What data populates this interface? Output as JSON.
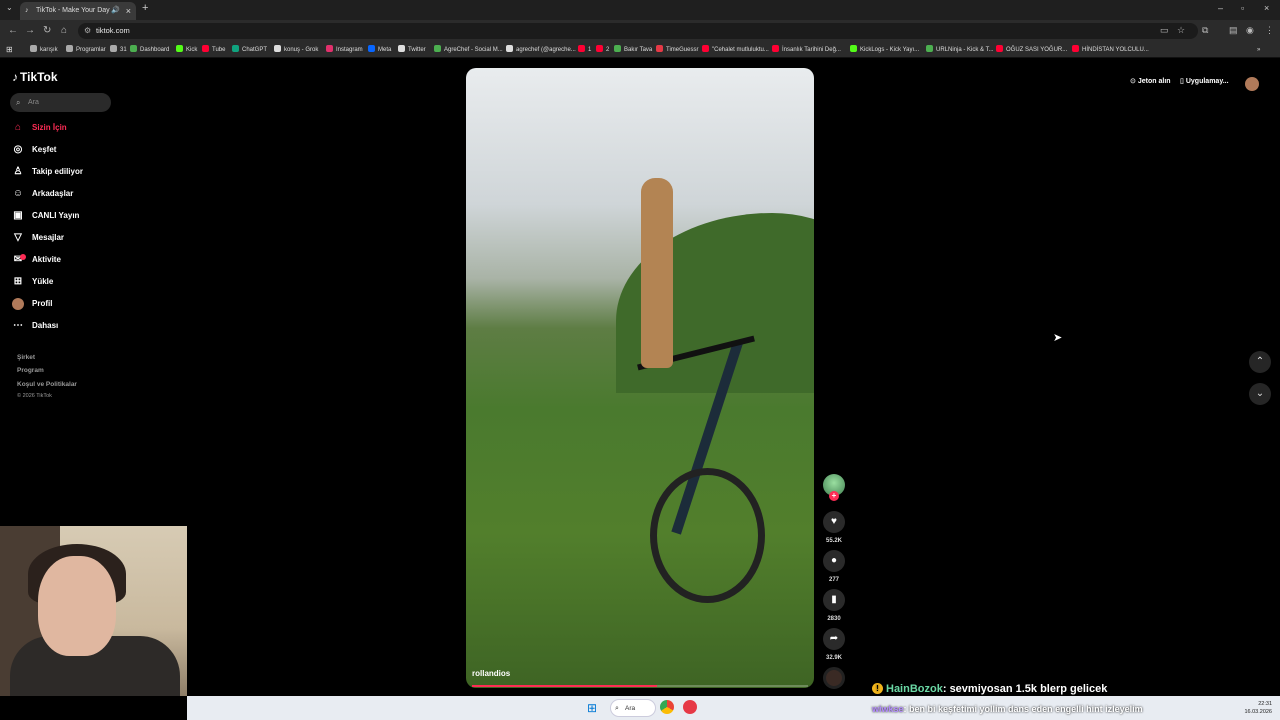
{
  "browser": {
    "tab_title": "TikTok - Make Your Day",
    "new_tab_symbol": "+",
    "url": "tiktok.com",
    "bookmarks": [
      "karışık",
      "Programlar",
      "31",
      "Dashboard",
      "Kick",
      "Tube",
      "ChatGPT",
      "konuş - Grok",
      "Instagram",
      "Meta",
      "Twitter",
      "AgreChef - Social M...",
      "agrechef (@agreche...",
      "1",
      "2",
      "Bakır Tava",
      "TimeGuessr",
      "\"Cehalet mutluluktu...",
      "İnsanlık Tarihini Değ...",
      "KickLogs - Kick Yayı...",
      "URLNinja - Kick & T...",
      "OĞUZ SASI YOĞUR...",
      "HİNDİSTAN YOLCULU..."
    ]
  },
  "sidebar": {
    "logo": "TikTok",
    "search_placeholder": "Ara",
    "items": [
      {
        "label": "Sizin İçin",
        "icon": "home-icon"
      },
      {
        "label": "Keşfet",
        "icon": "compass-icon"
      },
      {
        "label": "Takip ediliyor",
        "icon": "following-icon"
      },
      {
        "label": "Arkadaşlar",
        "icon": "friends-icon"
      },
      {
        "label": "CANLI Yayın",
        "icon": "live-icon"
      },
      {
        "label": "Mesajlar",
        "icon": "messages-icon"
      },
      {
        "label": "Aktivite",
        "icon": "activity-icon"
      },
      {
        "label": "Yükle",
        "icon": "upload-icon"
      },
      {
        "label": "Profil",
        "icon": "avatar"
      },
      {
        "label": "Dahası",
        "icon": "more-icon"
      }
    ],
    "footer": [
      "Şirket",
      "Program",
      "Koşul ve Politikalar"
    ],
    "copyright": "© 2026 TikTok"
  },
  "header": {
    "coins": "Jeton alın",
    "app": "Uygulamay..."
  },
  "video": {
    "author": "rollandios",
    "progress": 0.55,
    "likes": "55.2K",
    "comments": "277",
    "saves": "2830",
    "shares": "32.9K"
  },
  "chat": {
    "line1_user": "HainBozok",
    "line1_text": ": sevmiyosan 1.5k blerp gelicek",
    "line2_user": "wiwkse",
    "line2_text": ": ben bi keşfetimi yollim dans eden engelli hint izleyelim"
  },
  "taskbar": {
    "search": "Ara",
    "time": "22:31",
    "date": "16.03.2026"
  },
  "colors": {
    "accent": "#fe2c55"
  }
}
